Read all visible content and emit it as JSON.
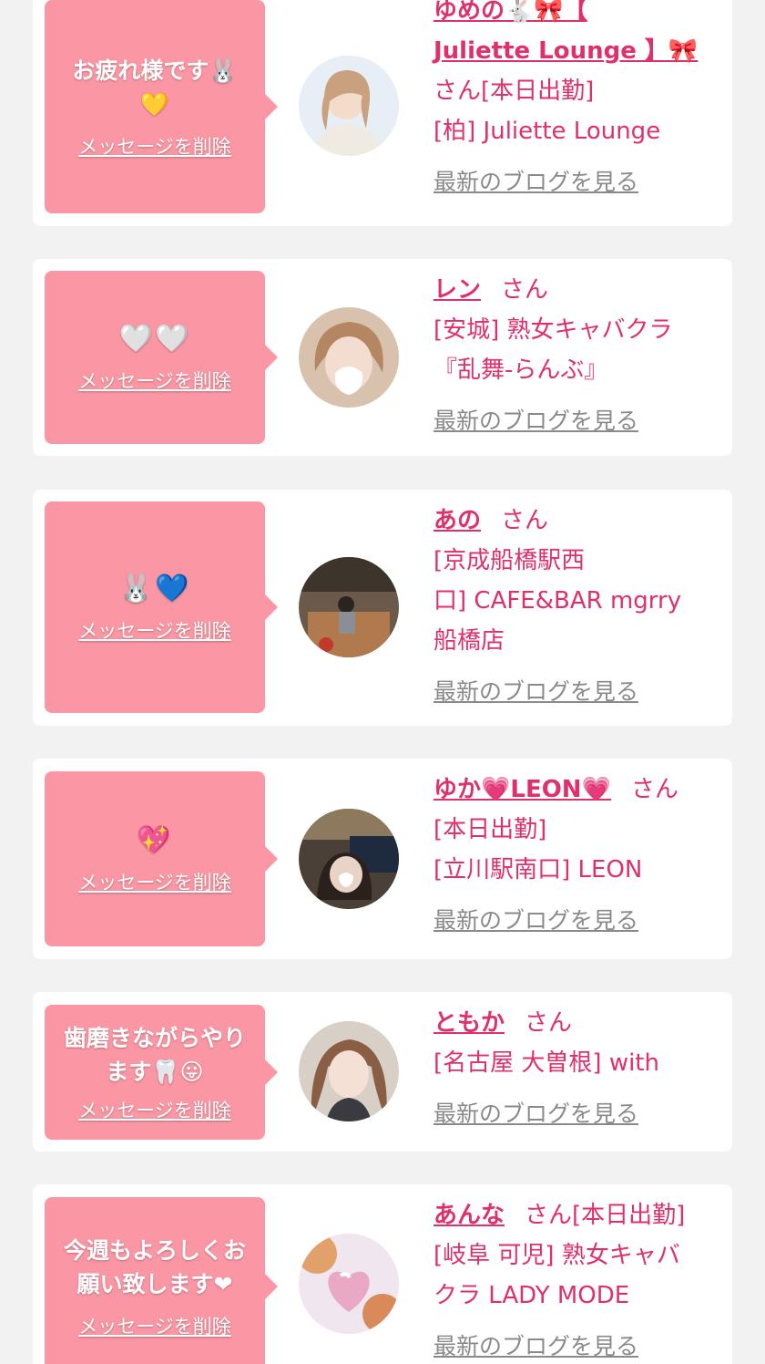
{
  "delete_label": "メッセージを削除",
  "blog_label": "最新のブログを見る",
  "honorific": "さん",
  "entries": [
    {
      "message_line1": "お疲れ様です🐰",
      "message_line2": "💛",
      "name_line1": "ゆめの🐇🎀【",
      "name_line2": "Juliette Lounge 】🎀",
      "status": "[本日出勤]",
      "shop": "[柏] Juliette Lounge"
    },
    {
      "message": "🤍🤍",
      "name": "レン",
      "shop": "[安城] 熟女キャバクラ『乱舞-らんぶ』"
    },
    {
      "message": "🐰💙",
      "name": "あの",
      "shop_line1": "[京成船橋駅西",
      "shop_line2": "口] CAFE&BAR mgrry",
      "shop_line3": "船橋店"
    },
    {
      "message": "💖",
      "name": "ゆか💗LEON💗",
      "status": "[本日出勤]",
      "shop": "[立川駅南口] LEON"
    },
    {
      "message_line1": "歯磨きながらやり",
      "message_line2": "ます🦷😛",
      "name": "ともか",
      "shop": "[名古屋 大曽根] with"
    },
    {
      "message_line1": "今週もよろしくお",
      "message_line2": "願い致します❤",
      "name": "あんな",
      "status": "[本日出勤]",
      "shop_line1": "[岐阜 可児] 熟女キャバ",
      "shop_line2": "クラ LADY MODE"
    }
  ],
  "colors": {
    "background": "#f2f2f2",
    "card": "#ffffff",
    "bubble": "#fb97a4",
    "accent_text": "#e0306a",
    "link_gray": "#8a8a8a"
  }
}
